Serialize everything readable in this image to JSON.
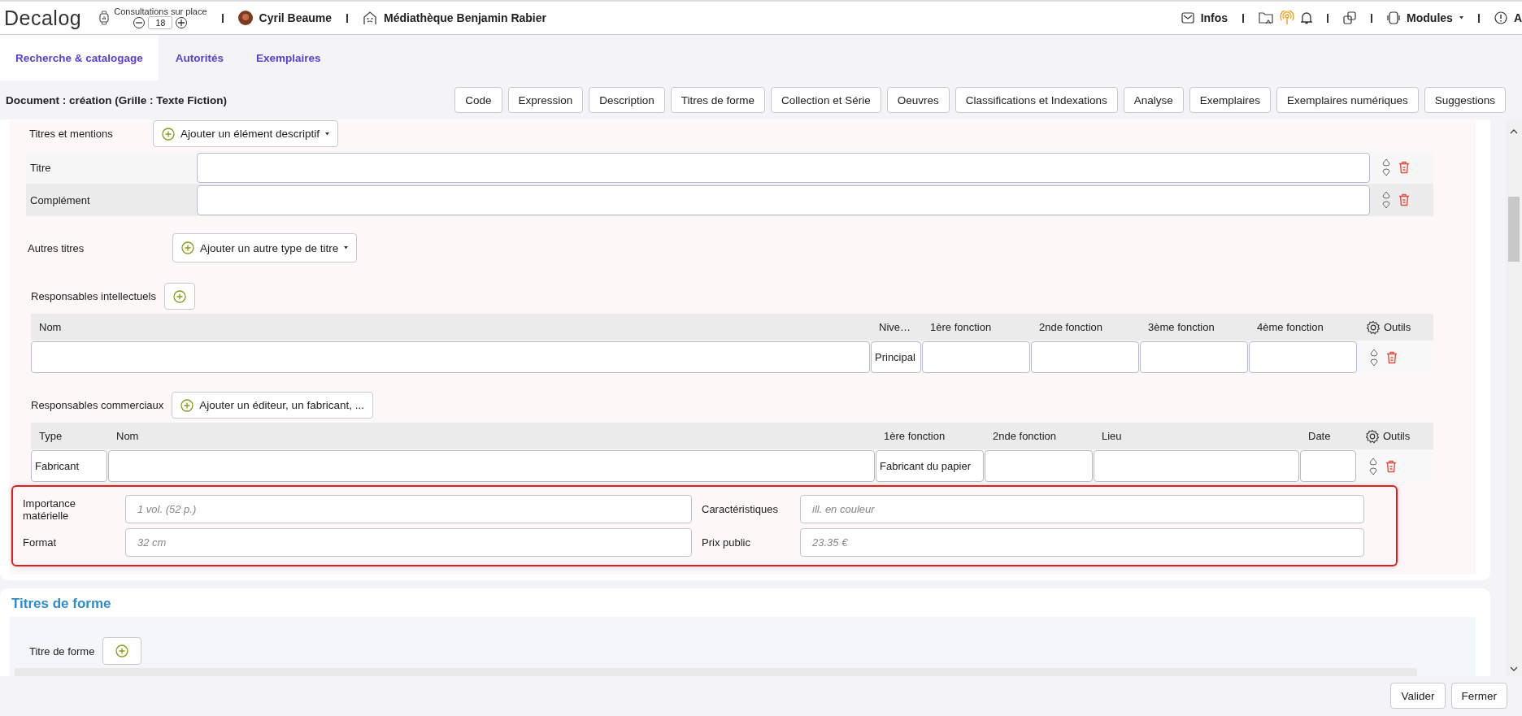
{
  "header": {
    "logo": "Decalog",
    "counter": {
      "label": "Consultations sur place",
      "value": "18"
    },
    "user": "Cyril Beaume",
    "library": "Médiathèque Benjamin Rabier",
    "infos": "Infos",
    "modules": "Modules",
    "help": "A"
  },
  "tabs": [
    {
      "label": "Recherche & catalogage",
      "selected": true
    },
    {
      "label": "Autorités",
      "selected": false
    },
    {
      "label": "Exemplaires",
      "selected": false
    }
  ],
  "document_title": "Document : création (Grille : Texte Fiction)",
  "section_buttons": [
    "Code",
    "Expression",
    "Description",
    "Titres de forme",
    "Collection et Série",
    "Oeuvres",
    "Classifications et Indexations",
    "Analyse",
    "Exemplaires",
    "Exemplaires numériques",
    "Suggestions"
  ],
  "titres_mentions": {
    "label": "Titres et mentions",
    "add_button": "Ajouter un élément descriptif",
    "rows": [
      {
        "label": "Titre"
      },
      {
        "label": "Complément"
      }
    ]
  },
  "autres_titres": {
    "label": "Autres titres",
    "add_button": "Ajouter un autre type de titre"
  },
  "resp_intellectuels": {
    "label": "Responsables intellectuels",
    "tools": "Outils",
    "columns": [
      {
        "label": "Nom"
      },
      {
        "label": "Nive…",
        "value": "Principal"
      },
      {
        "label": "1ère fonction"
      },
      {
        "label": "2nde fonction"
      },
      {
        "label": "3ème fonction"
      },
      {
        "label": "4ème fonction"
      }
    ]
  },
  "resp_commerciaux": {
    "label": "Responsables commerciaux",
    "add_button": "Ajouter un éditeur, un fabricant, ...",
    "tools": "Outils",
    "columns": [
      {
        "label": "Type",
        "value": "Fabricant"
      },
      {
        "label": "Nom"
      },
      {
        "label": "1ère fonction",
        "value": "Fabricant du papier"
      },
      {
        "label": "2nde fonction"
      },
      {
        "label": "Lieu"
      },
      {
        "label": "Date"
      }
    ]
  },
  "physical": {
    "highlighted": true,
    "fields": [
      {
        "label": "Importance matérielle",
        "placeholder": "1 vol. (52 p.)"
      },
      {
        "label": "Caractéristiques",
        "placeholder": "ill. en couleur"
      },
      {
        "label": "Format",
        "placeholder": "32 cm"
      },
      {
        "label": "Prix public",
        "placeholder": "23.35 €"
      }
    ]
  },
  "titres_de_forme": {
    "title": "Titres de forme",
    "label": "Titre de forme"
  },
  "footer_buttons": [
    "Valider",
    "Fermer"
  ]
}
